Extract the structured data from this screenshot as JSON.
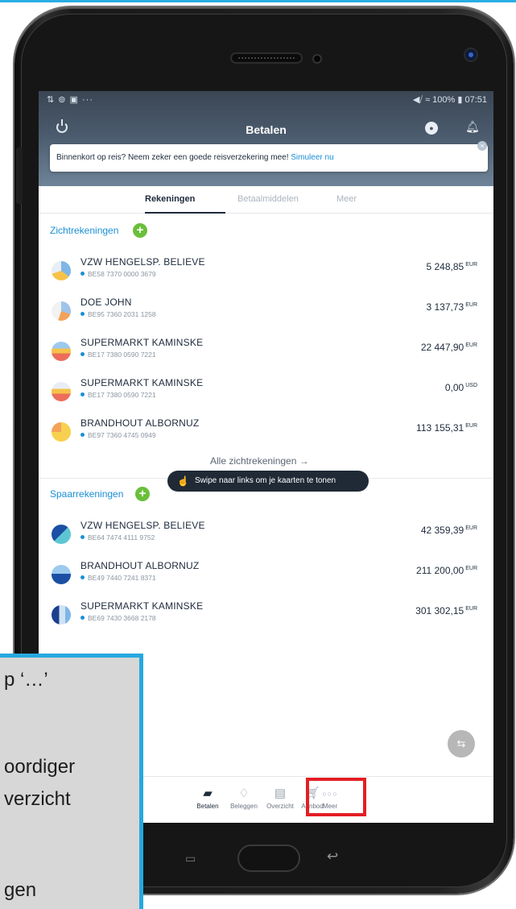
{
  "status_bar": {
    "left": "⇅ ⊚ ▣ ···",
    "right": "◀⧸ ≈ 100% ▮ 07:51"
  },
  "header": {
    "title": "Betalen"
  },
  "banner": {
    "text": "Binnenkort op reis? Neem zeker een goede reisverzekering mee! ",
    "link": "Simuleer nu"
  },
  "tabs": [
    {
      "label": "Rekeningen",
      "active": true
    },
    {
      "label": "Betaalmiddelen",
      "active": false
    },
    {
      "label": "Meer",
      "active": false
    }
  ],
  "zicht": {
    "title": "Zichtrekeningen",
    "accounts": [
      {
        "name": "VZW HENGELSP. BELIEVE",
        "iban": "BE58 7370 0000 3679",
        "amount": "5 248,85",
        "currency": "EUR"
      },
      {
        "name": "DOE JOHN",
        "iban": "BE95 7360 2031 1258",
        "amount": "3 137,73",
        "currency": "EUR"
      },
      {
        "name": "SUPERMARKT KAMINSKE",
        "iban": "BE17 7380 0590 7221",
        "amount": "22 447,90",
        "currency": "EUR"
      },
      {
        "name": "SUPERMARKT KAMINSKE",
        "iban": "BE17 7380 0590 7221",
        "amount": "0,00",
        "currency": "USD"
      },
      {
        "name": "BRANDHOUT ALBORNUZ",
        "iban": "BE97 7360 4745 0949",
        "amount": "113 155,31",
        "currency": "EUR"
      }
    ],
    "all_link": "Alle zichtrekeningen →"
  },
  "tooltip": {
    "text": "Swipe naar links om je kaarten te tonen"
  },
  "spaar": {
    "title": "Spaarrekeningen",
    "accounts": [
      {
        "name": "VZW HENGELSP. BELIEVE",
        "iban": "BE64 7474 4111 9752",
        "amount": "42 359,39",
        "currency": "EUR"
      },
      {
        "name": "BRANDHOUT ALBORNUZ",
        "iban": "BE49 7440 7241 8371",
        "amount": "211 200,00",
        "currency": "EUR"
      },
      {
        "name": "SUPERMARKT KAMINSKE",
        "iban": "BE69 7430 3668 2178",
        "amount": "301 302,15",
        "currency": "EUR"
      }
    ]
  },
  "bottom_nav": [
    {
      "label": "Betalen",
      "icon": "wallet-icon",
      "active": true
    },
    {
      "label": "Beleggen",
      "icon": "piggy-bank-icon",
      "active": false
    },
    {
      "label": "Overzicht",
      "icon": "overview-icon",
      "active": false
    },
    {
      "label": "Aanbod",
      "icon": "cart-icon",
      "active": false
    },
    {
      "label": "Meer",
      "icon": "more-dots-icon",
      "active": false
    }
  ],
  "callout": {
    "lines": [
      "p ‘…’",
      "oordiger",
      "verzicht",
      "gen"
    ]
  },
  "colors": {
    "accent": "#1a8fd6",
    "plus": "#6abf3a",
    "highlight": "#e31e24",
    "callout_border": "#26a9e0"
  }
}
